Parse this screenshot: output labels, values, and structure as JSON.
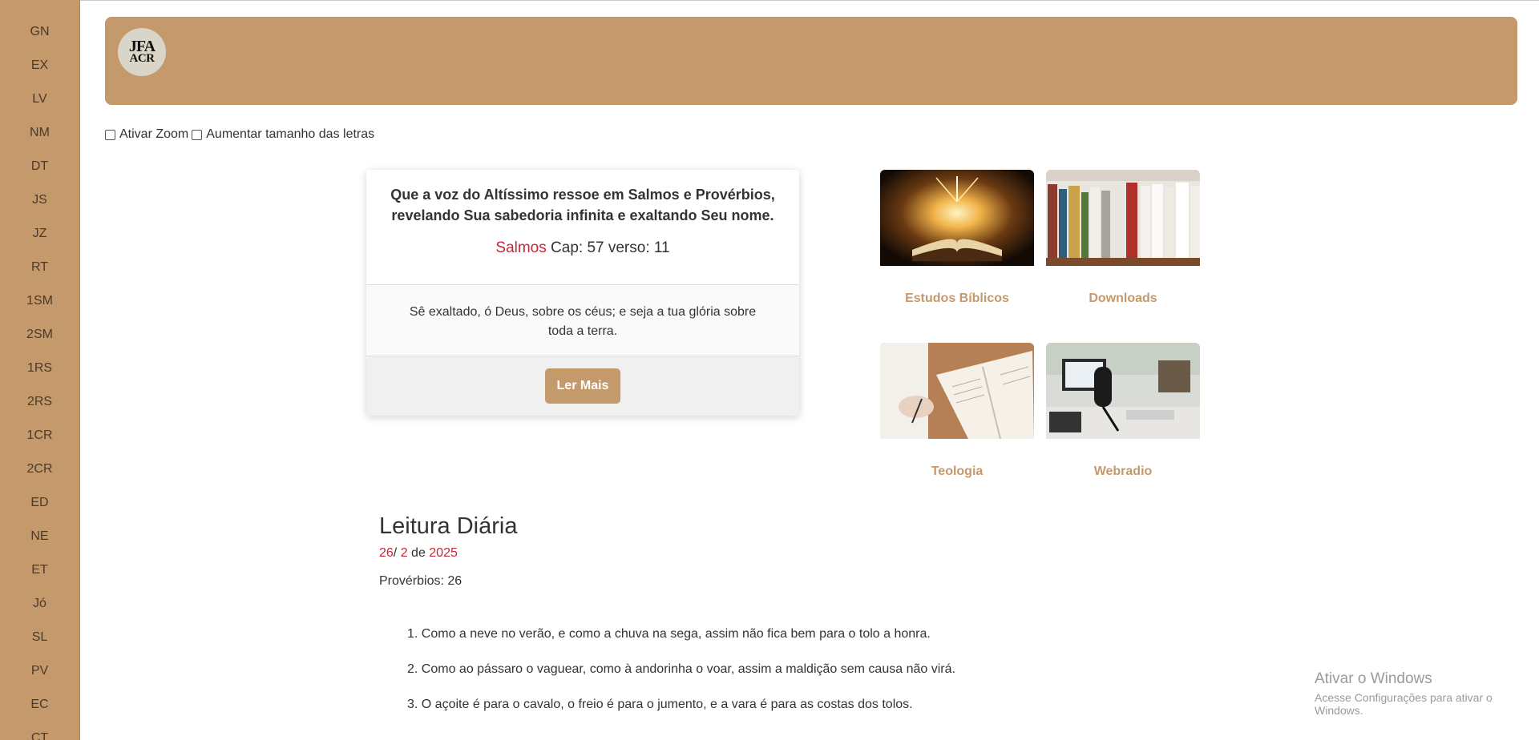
{
  "sidebar": {
    "items": [
      "GN",
      "EX",
      "LV",
      "NM",
      "DT",
      "JS",
      "JZ",
      "RT",
      "1SM",
      "2SM",
      "1RS",
      "2RS",
      "1CR",
      "2CR",
      "ED",
      "NE",
      "ET",
      "Jó",
      "SL",
      "PV",
      "EC",
      "CT"
    ]
  },
  "header": {
    "logo_line1": "JFA",
    "logo_line2": "ACR"
  },
  "options": {
    "zoom_label": "Ativar Zoom",
    "font_size_label": "Aumentar tamanho das letras"
  },
  "verse_card": {
    "intro": "Que a voz do Altíssimo ressoe em Salmos e Provérbios, revelando Sua sabedoria infinita e exaltando Seu nome.",
    "book": "Salmos",
    "ref_rest": " Cap: 57 verso: 11",
    "text": "Sê exaltado, ó Deus, sobre os céus; e seja a tua glória sobre toda a terra.",
    "button": "Ler Mais"
  },
  "tiles": [
    {
      "label": "Estudos Bíblicos",
      "icon": "glowing-bible-image"
    },
    {
      "label": "Downloads",
      "icon": "bookshelf-image"
    },
    {
      "label": "Teologia",
      "icon": "writing-study-image"
    },
    {
      "label": "Webradio",
      "icon": "microphone-studio-image"
    }
  ],
  "reading": {
    "title": "Leitura Diária",
    "day": "26",
    "month": "2",
    "sep1": "/ ",
    "sep2": " de ",
    "year": "2025",
    "ref": "Provérbios: 26",
    "verses": [
      "1. Como a neve no verão, e como a chuva na sega, assim não fica bem para o tolo a honra.",
      "2. Como ao pássaro o vaguear, como à andorinha o voar, assim a maldição sem causa não virá.",
      "3. O açoite é para o cavalo, o freio é para o jumento, e a vara é para as costas dos tolos."
    ]
  },
  "watermark": {
    "line1": "Ativar o Windows",
    "line2": "Acesse Configurações para ativar o Windows."
  },
  "colors": {
    "accent": "#c4996b",
    "highlight_red": "#c62838"
  }
}
